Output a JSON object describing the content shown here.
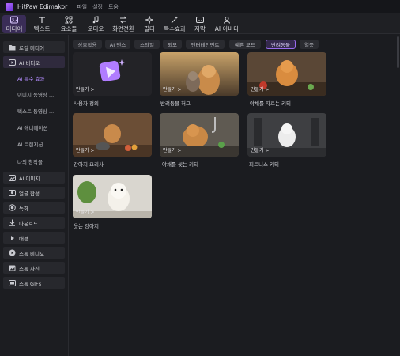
{
  "app": {
    "name": "HitPaw Edimakor"
  },
  "menu": [
    "파일",
    "설정",
    "도움"
  ],
  "toolbar": [
    {
      "label": "미디어",
      "icon": "media-icon"
    },
    {
      "label": "텍스트",
      "icon": "text-icon"
    },
    {
      "label": "요소들",
      "icon": "elements-icon"
    },
    {
      "label": "오디오",
      "icon": "audio-icon"
    },
    {
      "label": "화면전환",
      "icon": "transition-icon"
    },
    {
      "label": "필터",
      "icon": "filter-icon"
    },
    {
      "label": "특수효과",
      "icon": "effects-icon"
    },
    {
      "label": "자막",
      "icon": "subtitle-icon"
    },
    {
      "label": "AI 아바타",
      "icon": "ai-avatar-icon"
    }
  ],
  "sidebar": {
    "items": [
      {
        "label": "로컬 미디어",
        "icon": "folder-icon"
      },
      {
        "label": "AI 비디오",
        "icon": "ai-video-icon"
      },
      {
        "label": "AI 이미지",
        "icon": "ai-image-icon"
      },
      {
        "label": "얼굴 합성",
        "icon": "face-swap-icon"
      },
      {
        "label": "녹화",
        "icon": "record-icon"
      },
      {
        "label": "다운로드",
        "icon": "download-icon"
      },
      {
        "label": "배경",
        "icon": "background-icon"
      },
      {
        "label": "스톡 비디오",
        "icon": "stock-video-icon"
      },
      {
        "label": "스톡 사진",
        "icon": "stock-photo-icon"
      },
      {
        "label": "스톡 GIFs",
        "icon": "stock-gif-icon"
      }
    ],
    "subitems": [
      "AI 특수 효과",
      "이미지 동영상 ...",
      "텍스트 동영상 ...",
      "AI 애니메이션",
      "AI 트랜지션",
      "나의 창작물"
    ]
  },
  "chips": [
    "상호작용",
    "AI 댄스",
    "스타일",
    "외모",
    "엔터테인먼트",
    "예쁜 모드",
    "반려동물",
    "열풍"
  ],
  "cards": [
    {
      "title": "사용자 정의",
      "button": "만들기 >"
    },
    {
      "title": "반려동물 허그",
      "button": "만들기 >"
    },
    {
      "title": "야채를 자르는 키티",
      "button": "만들기 >"
    },
    {
      "title": "강아지 요리사",
      "button": "만들기 >"
    },
    {
      "title": "야채를 씻는 키티",
      "button": "만들기 >"
    },
    {
      "title": "피트니스 키티",
      "button": "만들기 >"
    },
    {
      "title": "웃는 강아지",
      "button": "만들기 >"
    }
  ],
  "colors": {
    "accent": "#9b6cf0",
    "bg": "#1b1c20",
    "panel": "#1c1d21"
  }
}
